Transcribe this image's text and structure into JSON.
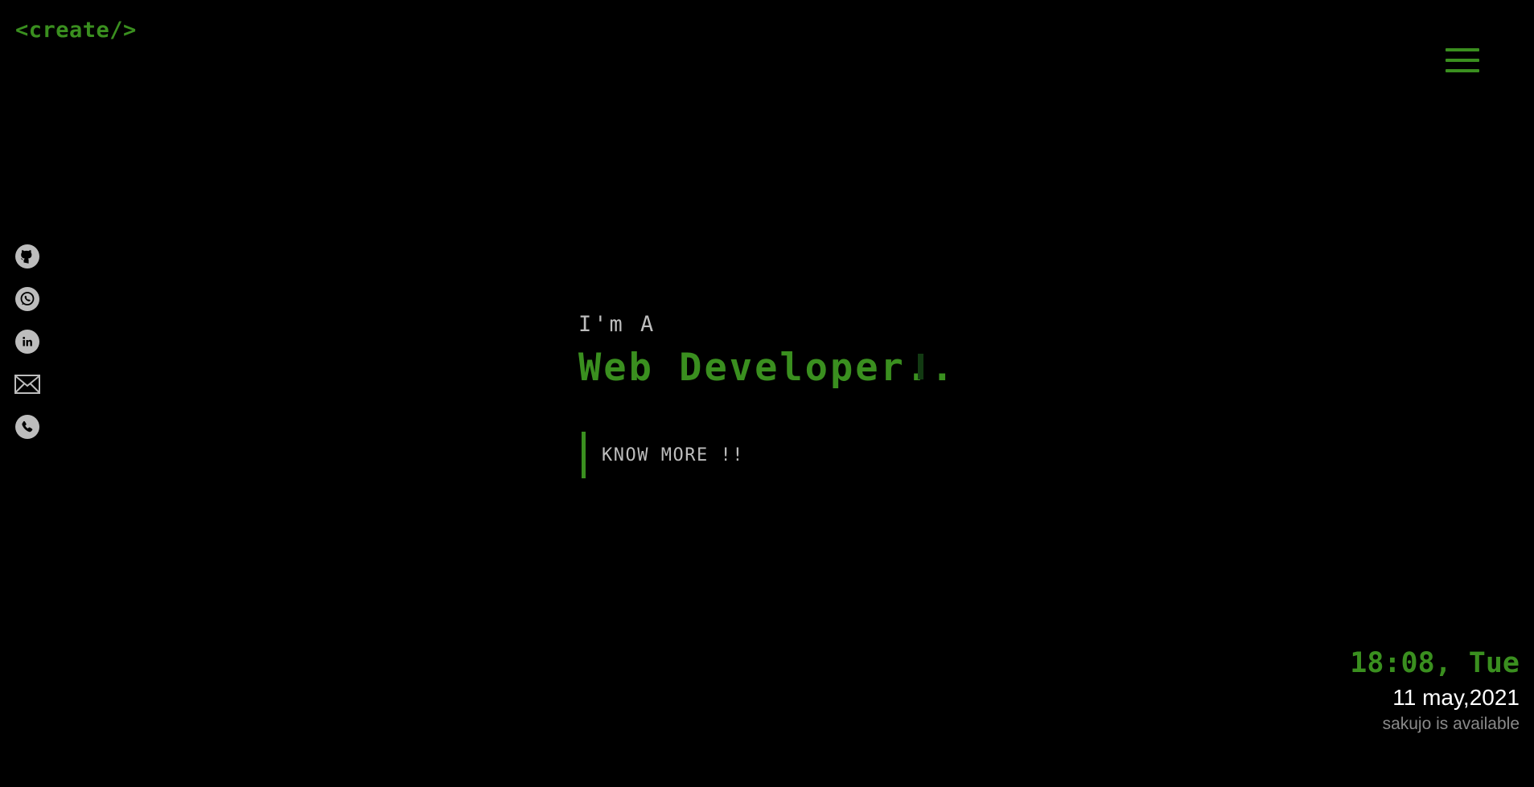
{
  "header": {
    "logo_text": "<create/>",
    "menu_icon": "hamburger-menu-icon"
  },
  "colors": {
    "accent": "#3a8f1f",
    "background": "#000000",
    "text_muted": "#bdbdbd",
    "icon_fill": "#bdbdbd"
  },
  "social": {
    "items": [
      {
        "name": "github",
        "icon": "github-icon"
      },
      {
        "name": "whatsapp",
        "icon": "whatsapp-icon"
      },
      {
        "name": "linkedin",
        "icon": "linkedin-icon"
      },
      {
        "name": "email",
        "icon": "mail-icon"
      },
      {
        "name": "phone",
        "icon": "phone-icon"
      }
    ]
  },
  "hero": {
    "prefix": "I'm A",
    "role": "Web Developer..",
    "cta_label": "KNOW MORE !!"
  },
  "clock": {
    "time": "18:08, Tue",
    "date": "11 may,2021",
    "status": "sakujo is available"
  }
}
